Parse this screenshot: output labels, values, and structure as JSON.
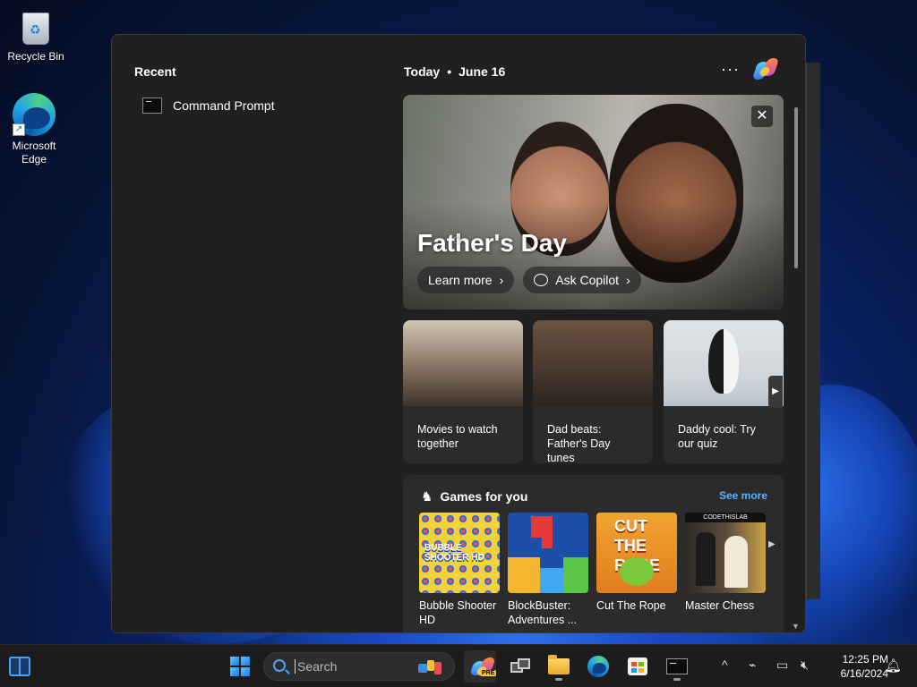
{
  "desktop": {
    "icons": [
      {
        "label": "Recycle Bin",
        "icon": "recycle-bin-icon"
      },
      {
        "label": "Microsoft Edge",
        "icon": "edge-icon"
      }
    ]
  },
  "panel": {
    "recent": {
      "title": "Recent",
      "items": [
        {
          "label": "Command Prompt",
          "icon": "command-prompt-icon"
        }
      ]
    },
    "feed": {
      "today_label": "Today",
      "separator": "•",
      "date": "June 16",
      "more_label": "···",
      "hero": {
        "title": "Father's Day",
        "close_label": "✕",
        "buttons": [
          {
            "label": "Learn more",
            "chevron": "›"
          },
          {
            "label": "Ask Copilot",
            "chevron": "›"
          }
        ]
      },
      "cards": [
        {
          "caption": "Movies to watch together"
        },
        {
          "caption": "Dad beats: Father's Day tunes"
        },
        {
          "caption": "Daddy cool: Try our quiz"
        }
      ],
      "games": {
        "title": "Games for you",
        "see_more": "See more",
        "items": [
          {
            "name": "Bubble Shooter HD",
            "art_text": "BUBBLE SHOOTER HD"
          },
          {
            "name": "BlockBuster: Adventures ...",
            "art_text": ""
          },
          {
            "name": "Cut The Rope",
            "art_text": "CUT THE ROPE"
          },
          {
            "name": "Master Chess",
            "art_text": "CODETHISLAB"
          }
        ]
      }
    }
  },
  "taskbar": {
    "search_placeholder": "Search",
    "clock_time": "12:25 PM",
    "clock_date": "6/16/2024",
    "pre_badge": "PRE",
    "tray_chevron": "^",
    "accent": "#4aa3ff"
  }
}
